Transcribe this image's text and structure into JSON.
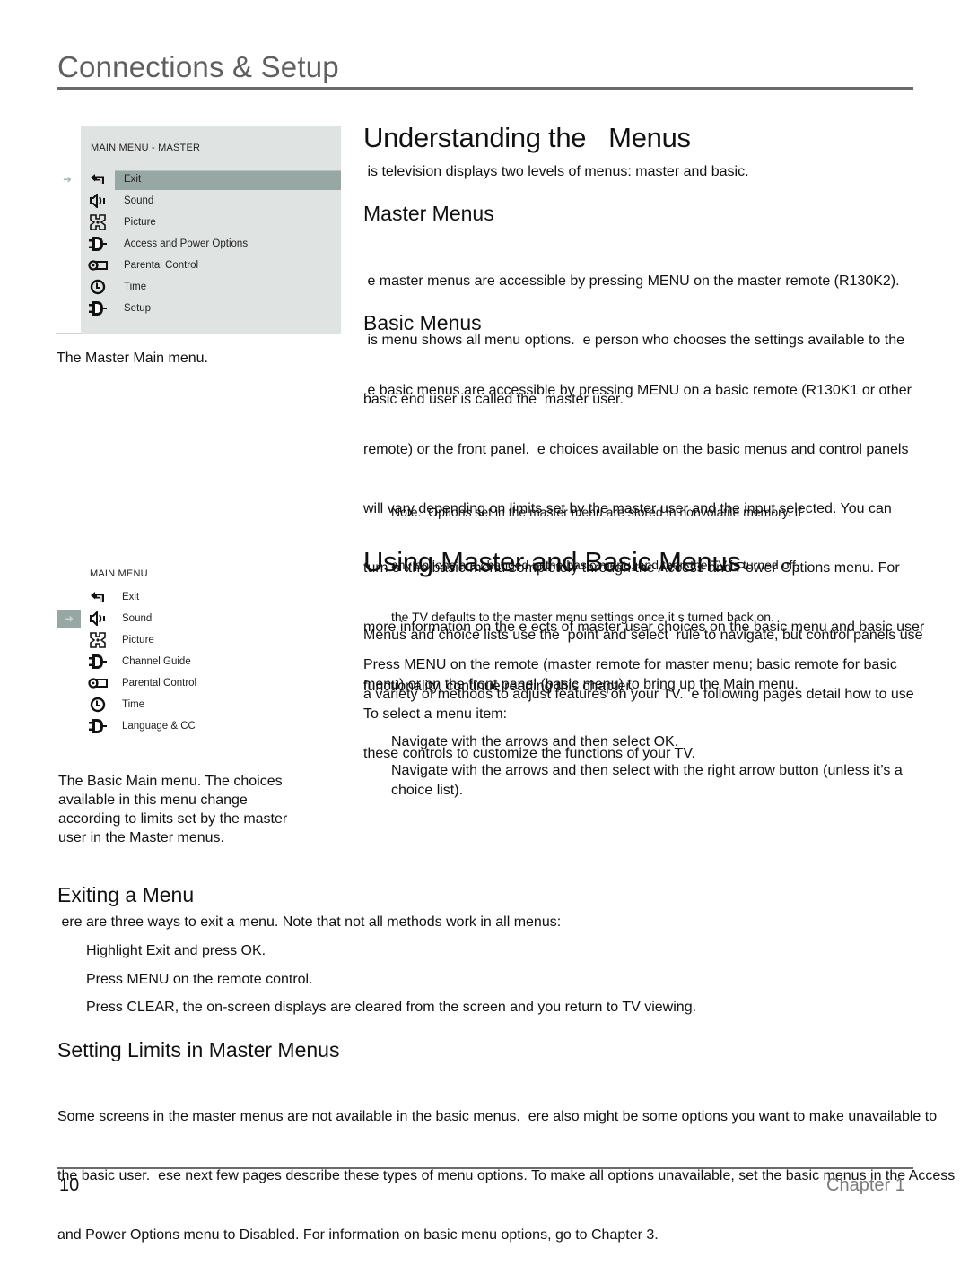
{
  "header": {
    "title": "Connections & Setup"
  },
  "master_menu": {
    "heading": "MAIN MENU - MASTER",
    "pointer_icon": "right-arrow-icon",
    "selected_index": 0,
    "items": [
      {
        "label": "Exit",
        "icon": "exit-icon"
      },
      {
        "label": "Sound",
        "icon": "sound-icon"
      },
      {
        "label": "Picture",
        "icon": "picture-icon"
      },
      {
        "label": "Access and Power Options",
        "icon": "plug-icon"
      },
      {
        "label": "Parental Control",
        "icon": "key-icon"
      },
      {
        "label": "Time",
        "icon": "clock-icon"
      },
      {
        "label": "Setup",
        "icon": "plug-icon"
      }
    ],
    "caption": "The Master Main menu."
  },
  "basic_menu": {
    "heading": "MAIN MENU",
    "pointer_icon": "right-arrow-icon",
    "selected_index": 1,
    "items": [
      {
        "label": "Exit",
        "icon": "exit-icon"
      },
      {
        "label": "Sound",
        "icon": "sound-icon"
      },
      {
        "label": "Picture",
        "icon": "picture-icon"
      },
      {
        "label": "Channel Guide",
        "icon": "plug-icon"
      },
      {
        "label": "Parental Control",
        "icon": "key-icon"
      },
      {
        "label": "Time",
        "icon": "clock-icon"
      },
      {
        "label": "Language & CC",
        "icon": "plug-icon"
      }
    ],
    "caption_lines": [
      "The Basic Main menu. The choices",
      "available in this menu change",
      "according to limits set by the master",
      "user in the Master menus."
    ]
  },
  "understanding": {
    "title": "Understanding the   Menus",
    "intro": " is television displays two levels of menus: master and basic.",
    "master": {
      "title": "Master Menus",
      "lines": [
        " e master menus are accessible by pressing MENU on the master remote (R130K2).",
        " is menu shows all menu options.  e person who chooses the settings available to the",
        "basic end user is called the  master user."
      ]
    },
    "basic": {
      "title": "Basic Menus",
      "lines": [
        " e basic menus are accessible by pressing MENU on a basic remote (R130K1 or other",
        "remote) or the front panel.  e choices available on the basic menus and control panels",
        "will vary depending on limits set by the master user and the input selected. You can",
        "turn o  the basic menu completely through the Access and Power Options menu. For",
        "more information on the e ects of master user choices on the basic menu and basic user",
        "functionality, continue reading this chapter."
      ]
    },
    "note_lines": [
      "Note:  Options set in the master menu are stored in nonvolatile memory. If",
      "any options are changed in the basic menu, and then the TV is turned off,",
      "the TV defaults to the master menu settings once it s turned back on."
    ]
  },
  "using": {
    "title": "Using Master and Basic Menus",
    "para1": [
      "Menus and choice lists use the  point and select  rule to navigate, but control panels use",
      "a variety of methods to adjust features on your TV.  e following pages detail how to use",
      "these controls to customize the functions of your TV."
    ],
    "para2": [
      "Press MENU on the remote (master remote for master menu; basic remote for basic",
      "menu) or on the front panel (basic menu) to bring up the Main menu."
    ],
    "select_intro": "To select a menu item:",
    "steps": [
      [
        "Navigate with the arrows and then select OK."
      ],
      [
        "Navigate with the arrows and then select with the right arrow button (unless it’s a",
        "choice list)."
      ]
    ]
  },
  "exiting": {
    "title": "Exiting a Menu",
    "intro": " ere are three ways to exit a menu. Note that not all methods work in all menus:",
    "methods": [
      "Highlight Exit and press OK.",
      "Press MENU on the remote control.",
      "Press CLEAR, the on-screen displays are cleared from the screen and you return to TV viewing."
    ]
  },
  "limits": {
    "title": "Setting Limits in Master Menus",
    "lines": [
      "Some screens in the master menus are not available in the basic menus.  ere also might be some options you want to make unavailable to",
      "the basic user.  ese next few pages describe these types of menu options. To make all options unavailable, set the basic menus in the Access",
      "and Power Options menu to Disabled. For information on basic menu options, go to Chapter 3."
    ]
  },
  "footer": {
    "page_number": "10",
    "chapter": "Chapter 1"
  },
  "colors": {
    "menu_panel_bg": "#dfe4e2",
    "menu_selected": "#97a7a3",
    "title_gray": "#5f5f5f",
    "rule_gray": "#6a6a6a"
  }
}
